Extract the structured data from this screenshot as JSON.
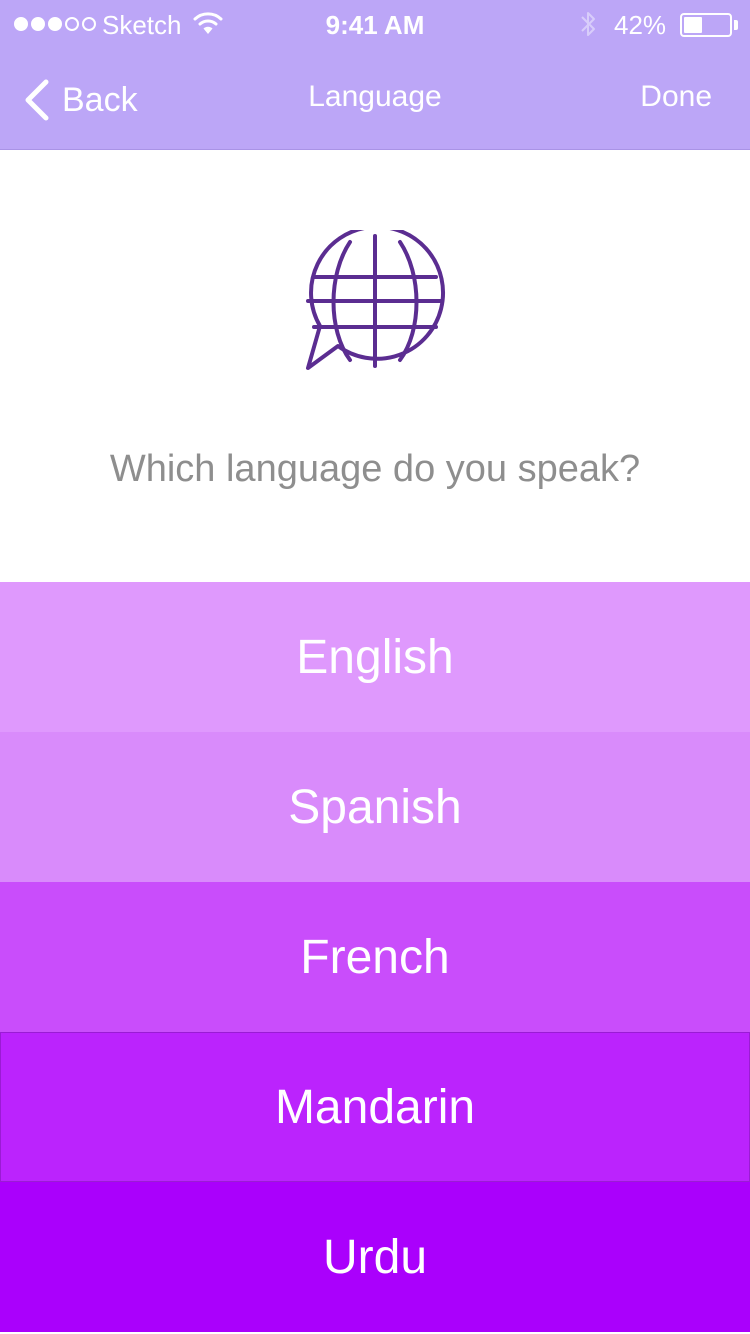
{
  "status_bar": {
    "carrier": "Sketch",
    "time": "9:41 AM",
    "battery_percent_label": "42%",
    "battery_level": 0.42,
    "signal_dots_filled": 3,
    "signal_dots_total": 5,
    "icons": [
      "signal-dots-icon",
      "wifi-icon",
      "bluetooth-icon",
      "battery-icon"
    ]
  },
  "nav": {
    "back_label": "Back",
    "title": "Language",
    "done_label": "Done"
  },
  "main": {
    "icon": "globe-speech-bubble-icon",
    "prompt": "Which language do you speak?"
  },
  "languages": [
    {
      "label": "English",
      "color": "#df99fd"
    },
    {
      "label": "Spanish",
      "color": "#d98bfb"
    },
    {
      "label": "French",
      "color": "#c94dfb"
    },
    {
      "label": "Mandarin",
      "color": "#bb23fd"
    },
    {
      "label": "Urdu",
      "color": "#aa00fc"
    }
  ],
  "colors": {
    "header_background": "#bca6f7",
    "icon_stroke": "#5b2d91",
    "prompt_text": "#8e8e8e"
  }
}
